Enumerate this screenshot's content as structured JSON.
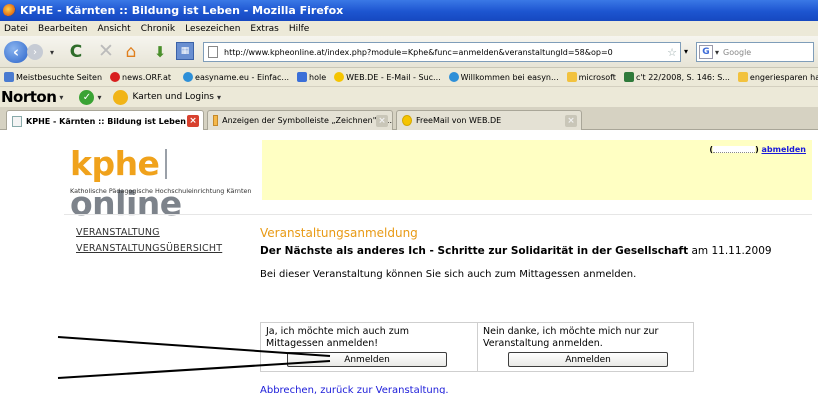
{
  "window": {
    "title": "KPHE - Kärnten :: Bildung ist Leben - Mozilla Firefox"
  },
  "menu": [
    {
      "label": "Datei"
    },
    {
      "label": "Bearbeiten"
    },
    {
      "label": "Ansicht"
    },
    {
      "label": "Chronik"
    },
    {
      "label": "Lesezeichen"
    },
    {
      "label": "Extras"
    },
    {
      "label": "Hilfe"
    }
  ],
  "nav": {
    "url": "http://www.kpheonline.at/index.php?module=Kphe&func=anmelden&veranstaltungId=58&op=0",
    "search_placeholder": "Google",
    "search_engine_letter": "G"
  },
  "bookmarks": [
    {
      "label": "Meistbesuchte Seiten",
      "icon": "page-icon",
      "color": "#4a7bd0"
    },
    {
      "label": "news.ORF.at",
      "icon": "orf-icon",
      "color": "#d81e1e"
    },
    {
      "label": "easyname.eu - Einfac...",
      "icon": "ie-icon",
      "color": "#2d8fd8"
    },
    {
      "label": "hole",
      "icon": "hole-icon",
      "color": "#3b6fd8"
    },
    {
      "label": "WEB.DE - E-Mail - Suc...",
      "icon": "webde-icon",
      "color": "#f5c400"
    },
    {
      "label": "Willkommen bei easyn...",
      "icon": "ie-icon",
      "color": "#2d8fd8"
    },
    {
      "label": "microsoft",
      "icon": "folder-icon",
      "color": "#f2c23e"
    },
    {
      "label": "c't 22/2008, S. 146: S...",
      "icon": "ct-icon",
      "color": "#2f7a3a"
    },
    {
      "label": "engeriesparen hausis...",
      "icon": "folder-icon",
      "color": "#f2c23e"
    }
  ],
  "norton": {
    "brand": "Norton",
    "cards_label": "Karten und Logins"
  },
  "tabs": [
    {
      "label": "KPHE - Kärnten :: Bildung ist Leben",
      "active": true
    },
    {
      "label": "Anzeigen der Symbolleiste „Zeichnen\" - ...",
      "active": false
    },
    {
      "label": "FreeMail von WEB.DE",
      "active": false
    }
  ],
  "site": {
    "logo_kphe": "kphe",
    "logo_online": "online",
    "logo_subtitle": "Katholische Pädagogische Hochschuleinrichtung Kärnten",
    "user_open": "(",
    "user_close": ")",
    "logout_label": "abmelden",
    "sidenav": [
      {
        "label": "VERANSTALTUNG"
      },
      {
        "label": "VERANSTALTUNGSÜBERSICHT"
      }
    ],
    "section_title": "Veranstaltungsanmeldung",
    "event_title": "Der Nächste als anderes Ich - Schritte zur Solidarität in der Gesellschaft",
    "event_date_prefix": "am",
    "event_date": "11.11.2009",
    "info_text": "Bei dieser Veranstaltung können Sie sich auch zum Mittagessen anmelden.",
    "option_yes": "Ja, ich möchte mich auch zum Mittagessen anmelden!",
    "option_no": "Nein danke, ich möchte mich nur zur Veranstaltung anmelden.",
    "register_label": "Anmelden",
    "cancel_link": "Abbrechen, zurück zur Veranstaltung."
  },
  "colors": {
    "brand_orange": "#f0a21b",
    "header_yellow": "#ffffc3",
    "link_blue": "#1b1bd9"
  }
}
